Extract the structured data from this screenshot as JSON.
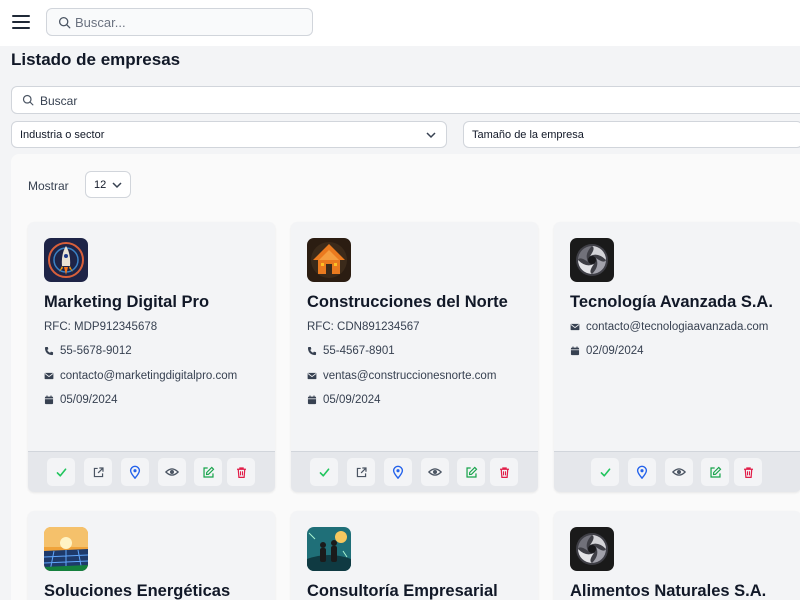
{
  "header": {
    "search_placeholder": "Buscar..."
  },
  "page": {
    "title": "Listado de empresas"
  },
  "filters": {
    "search_placeholder": "Buscar",
    "industry_label": "Industria o sector",
    "size_label": "Tamaño de la empresa"
  },
  "pagination": {
    "show_label": "Mostrar",
    "page_size": "12"
  },
  "colors": {
    "check": "#22c55e",
    "external": "#4b5563",
    "location": "#2563eb",
    "view": "#4b5563",
    "edit": "#16a34a",
    "delete": "#e11d48"
  },
  "companies": [
    {
      "name": "Marketing Digital Pro",
      "rfc": "RFC: MDP912345678",
      "phone": "55-5678-9012",
      "email": "contacto@marketingdigitalpro.com",
      "date": "05/09/2024",
      "logo": "rocket-logo"
    },
    {
      "name": "Construcciones del Norte",
      "rfc": "RFC: CDN891234567",
      "phone": "55-4567-8901",
      "email": "ventas@construccionesnorte.com",
      "date": "05/09/2024",
      "logo": "house-logo"
    },
    {
      "name": "Tecnología Avanzada S.A.",
      "email": "contacto@tecnologiaavanzada.com",
      "date": "02/09/2024",
      "logo": "swirl-logo"
    },
    {
      "name": "Soluciones Energéticas",
      "logo": "solar-logo"
    },
    {
      "name": "Consultoría Empresarial",
      "logo": "people-logo"
    },
    {
      "name": "Alimentos Naturales S.A.",
      "logo": "swirl-logo"
    }
  ]
}
